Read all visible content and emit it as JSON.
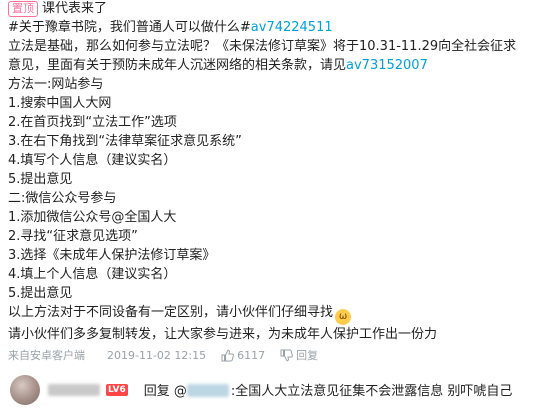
{
  "post": {
    "pin_label": "置顶",
    "title": "课代表来了",
    "lines": [
      {
        "text": "#关于豫章书院，我们普通人可以做什么#",
        "link": "av74224511",
        "after": ""
      },
      {
        "text": "立法是基础，那么如何参与立法呢？《未保法修订草案》将于10.31-11.29向全社会征求",
        "link": "",
        "after": ""
      },
      {
        "text": "意见，里面有关于预防未成年人沉迷网络的相关条款，请见",
        "link": "av73152007",
        "after": ""
      },
      {
        "text": "方法一:网站参与",
        "link": "",
        "after": ""
      },
      {
        "text": "1.搜索中国人大网",
        "link": "",
        "after": ""
      },
      {
        "text": "2.在首页找到“立法工作”选项",
        "link": "",
        "after": ""
      },
      {
        "text": "3.在右下角找到“法律草案征求意见系统”",
        "link": "",
        "after": ""
      },
      {
        "text": "4.填写个人信息（建议实名）",
        "link": "",
        "after": ""
      },
      {
        "text": "5.提出意见",
        "link": "",
        "after": ""
      },
      {
        "text": "二:微信公众号参与",
        "link": "",
        "after": ""
      },
      {
        "text": "1.添加微信公众号@全国人大",
        "link": "",
        "after": ""
      },
      {
        "text": "2.寻找“征求意见选项”",
        "link": "",
        "after": ""
      },
      {
        "text": "3.选择《未成年人保护法修订草案》",
        "link": "",
        "after": ""
      },
      {
        "text": "4.填上个人信息（建议实名）",
        "link": "",
        "after": ""
      },
      {
        "text": "5.提出意见",
        "link": "",
        "after": ""
      },
      {
        "text": "以上方法对于不同设备有一定区别，请小伙伴们仔细寻找",
        "link": "",
        "after": ""
      },
      {
        "text": "请小伙伴们多多复制转发，让大家参与进来，为未成年人保护工作出一份力",
        "link": "",
        "after": ""
      }
    ]
  },
  "meta": {
    "device": "来自安卓客户端",
    "timestamp": "2019-11-02 12:15",
    "like_count": "6117",
    "reply_label": "回复"
  },
  "reply": {
    "level": "LV6",
    "prefix": "回复 @",
    "content": ":全国人大立法意见征集不会泄露信息 别吓唬自己"
  },
  "colors": {
    "link": "#00a1d6",
    "pin": "#fb7299",
    "meta": "#99a2aa",
    "level": "#ff4545"
  }
}
